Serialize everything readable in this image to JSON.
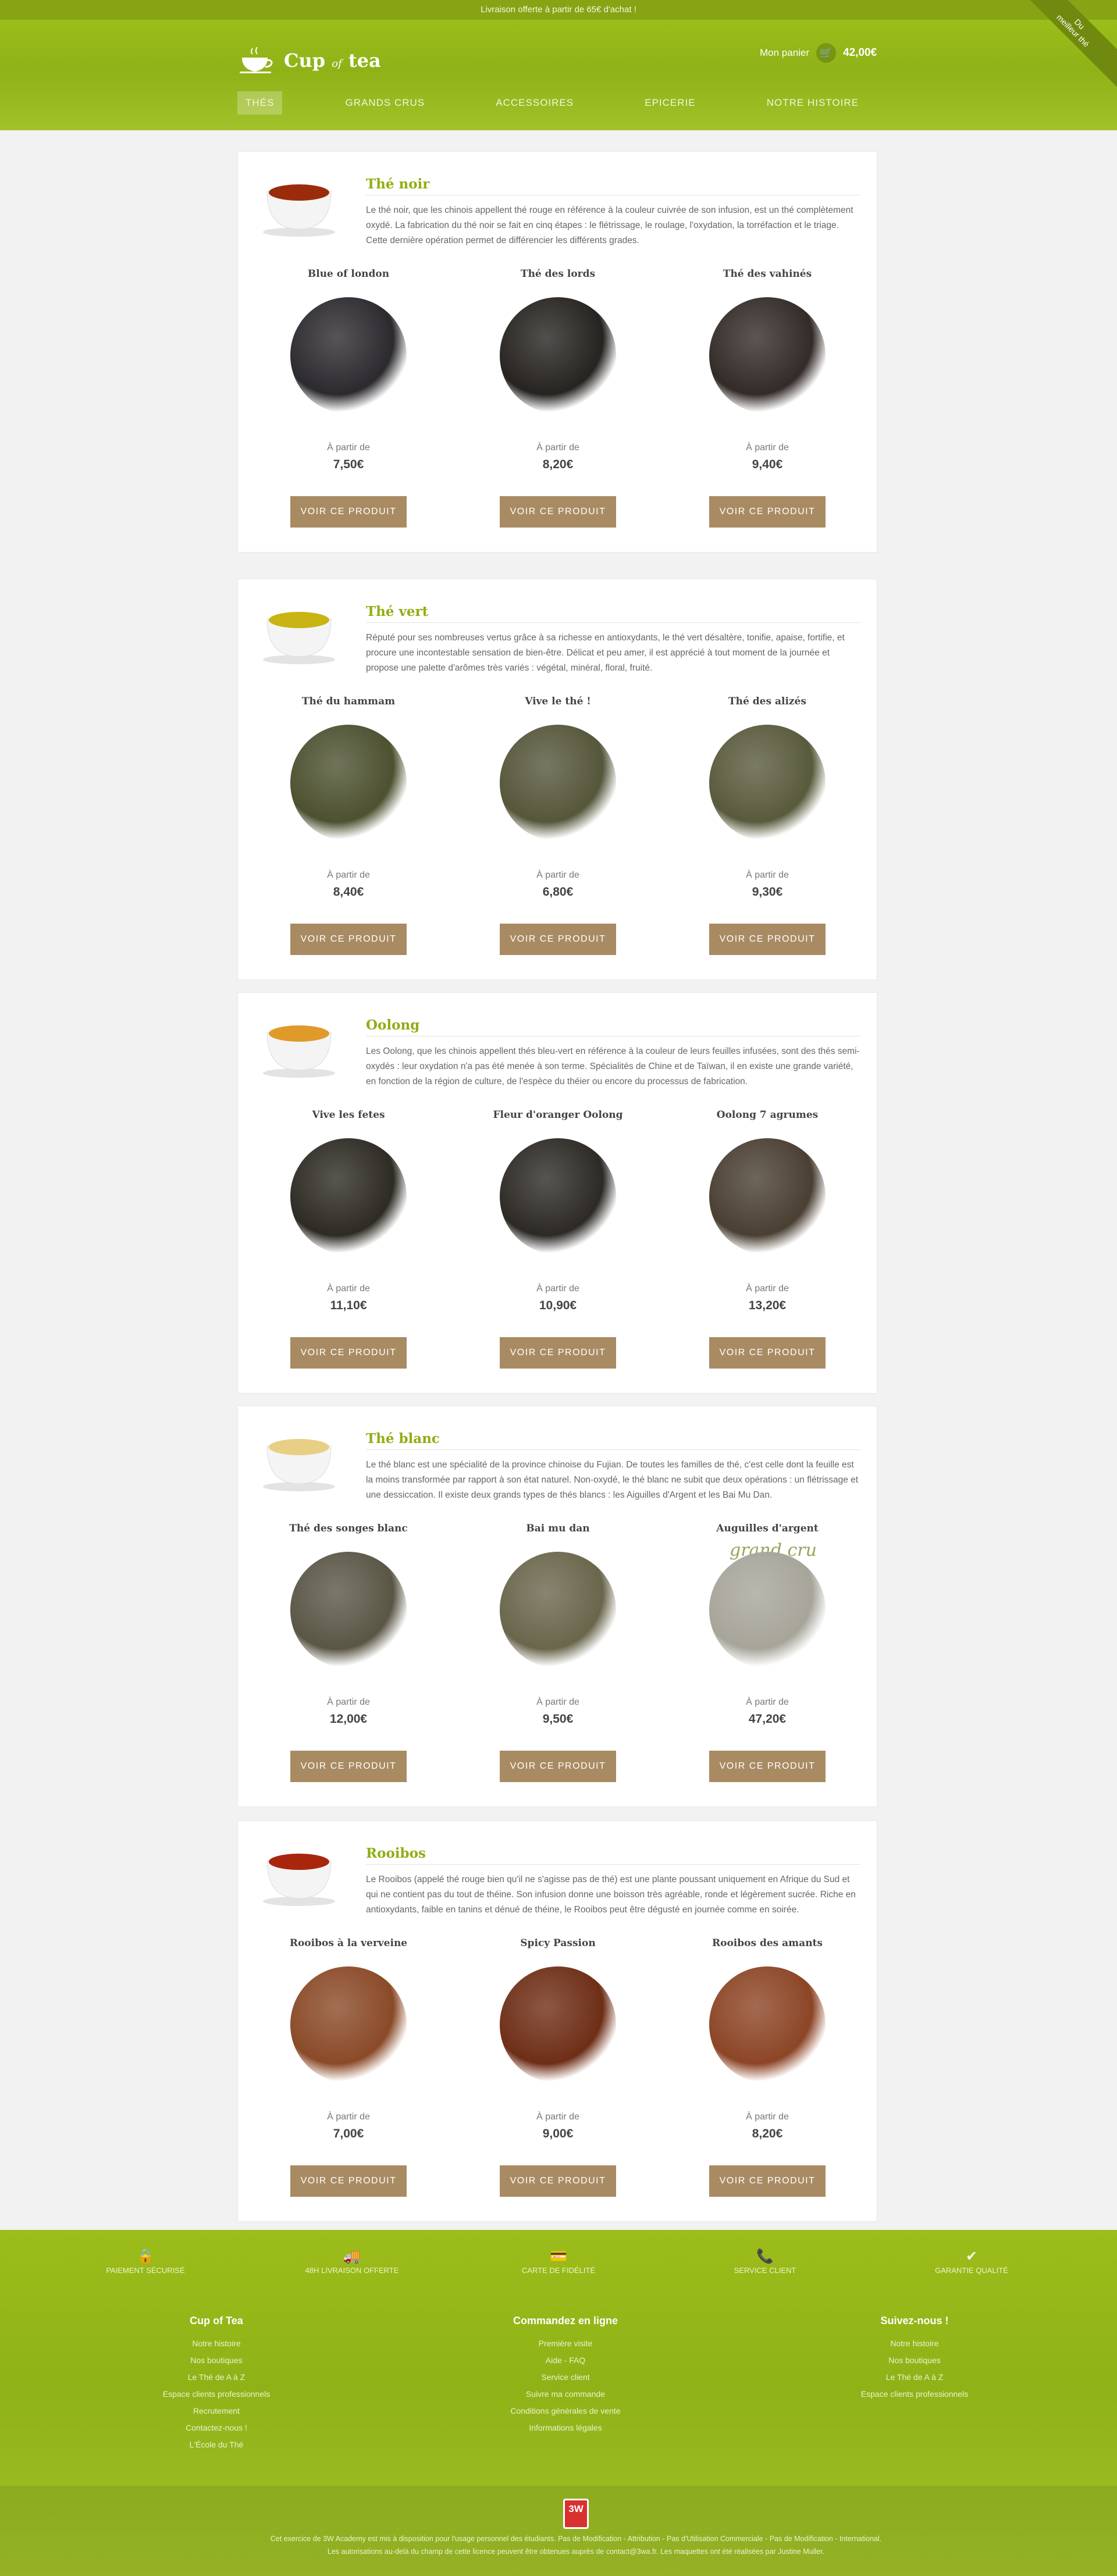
{
  "topbar": {
    "text": "Livraison offerte à partir de 65€ d'achat !"
  },
  "ribbon": {
    "line1": "Du",
    "line2": "meilleur thé"
  },
  "logo": {
    "word1": "Cup",
    "word2": "of",
    "word3": "tea"
  },
  "cart": {
    "label": "Mon panier",
    "amount": "42,00€",
    "icon": "cart-icon"
  },
  "nav": {
    "items": [
      "THÉS",
      "GRANDS CRUS",
      "ACCESSOIRES",
      "EPICERIE",
      "NOTRE HISTOIRE"
    ]
  },
  "sections": [
    {
      "title": "Thé noir",
      "bowl_color": "#9a2c0c",
      "desc": "Le thé noir, que les chinois appellent thé rouge en référence à la couleur cuivrée de son infusion, est un thé complètement oxydé. La fabrication du thé noir se fait en cinq étapes : le flétrissage, le roulage, l'oxydation, la torréfaction et le triage. Cette dernière opération permet de différencier les différents grades.",
      "products": [
        {
          "name": "Blue of london",
          "from": "À partir de",
          "price": "7,50€",
          "button": "VOIR CE PRODUIT",
          "color": "#2c2a2e"
        },
        {
          "name": "Thé des lords",
          "from": "À partir de",
          "price": "8,20€",
          "button": "VOIR CE PRODUIT",
          "color": "#262320"
        },
        {
          "name": "Thé des vahinés",
          "from": "À partir de",
          "price": "9,40€",
          "button": "VOIR CE PRODUIT",
          "color": "#332b28"
        }
      ]
    },
    {
      "title": "Thé vert",
      "bowl_color": "#c8b414",
      "desc": "Réputé pour ses nombreuses vertus grâce à sa richesse en antioxydants, le thé vert désaltère, tonifie, apaise, fortifie, et procure une incontestable sensation de bien-être. Délicat et peu amer, il est apprécié à tout moment de la journée et propose une palette d'arômes très variés : végétal, minéral, floral, fruité.",
      "products": [
        {
          "name": "Thé du hammam",
          "from": "À partir de",
          "price": "8,40€",
          "button": "VOIR CE PRODUIT",
          "color": "#4d5130"
        },
        {
          "name": "Vive le thé !",
          "from": "À partir de",
          "price": "6,80€",
          "button": "VOIR CE PRODUIT",
          "color": "#55563a"
        },
        {
          "name": "Thé des alizés",
          "from": "À partir de",
          "price": "9,30€",
          "button": "VOIR CE PRODUIT",
          "color": "#595a3c"
        }
      ]
    },
    {
      "title": "Oolong",
      "bowl_color": "#e09a2a",
      "desc": "Les Oolong, que les chinois appellent thés bleu-vert en référence à la couleur de leurs feuilles infusées, sont des thés semi-oxydés : leur oxydation n'a pas été menée à son terme. Spécialités de Chine et de Taïwan, il en existe une grande variété, en fonction de la région de culture, de l'espèce du théier ou encore du processus de fabrication.",
      "products": [
        {
          "name": "Vive les fetes",
          "from": "À partir de",
          "price": "11,10€",
          "button": "VOIR CE PRODUIT",
          "color": "#2e2b24"
        },
        {
          "name": "Fleur d'oranger Oolong",
          "from": "À partir de",
          "price": "10,90€",
          "button": "VOIR CE PRODUIT",
          "color": "#2d2a26"
        },
        {
          "name": "Oolong 7 agrumes",
          "from": "À partir de",
          "price": "13,20€",
          "button": "VOIR CE PRODUIT",
          "color": "#4a3f32"
        }
      ]
    },
    {
      "title": "Thé blanc",
      "bowl_color": "#e8cf86",
      "desc": "Le thé blanc est une spécialité de la province chinoise du Fujian. De toutes les familles de thé, c'est celle dont la feuille est la moins transformée par rapport à son état naturel. Non-oxydé, le thé blanc ne subit que deux opérations : un flétrissage et une dessiccation. Il existe deux grands types de thés blancs : les Aiguilles d'Argent et les Bai Mu Dan.",
      "products": [
        {
          "name": "Thé des songes blanc",
          "from": "À partir de",
          "price": "12,00€",
          "button": "VOIR CE PRODUIT",
          "color": "#5a5646",
          "extra": ""
        },
        {
          "name": "Bai mu dan",
          "from": "À partir de",
          "price": "9,50€",
          "button": "VOIR CE PRODUIT",
          "color": "#6a664c",
          "extra": ""
        },
        {
          "name": "Auguilles d'argent",
          "from": "À partir de",
          "price": "47,20€",
          "button": "VOIR CE PRODUIT",
          "color": "#a7a59a",
          "extra": "grand cru"
        }
      ]
    },
    {
      "title": "Rooibos",
      "bowl_color": "#a8260c",
      "desc": "Le Rooibos (appelé thé rouge bien qu'il ne s'agisse pas de thé) est une plante poussant uniquement en Afrique du Sud et qui ne contient pas du tout de théine. Son infusion donne une boisson très agréable, ronde et légèrement sucrée. Riche en antioxydants, faible en tanins et dénué de théine, le Rooibos peut être dégusté en journée comme en soirée.",
      "products": [
        {
          "name": "Rooibos à la verveine",
          "from": "À partir de",
          "price": "7,00€",
          "button": "VOIR CE PRODUIT",
          "color": "#8a4a28"
        },
        {
          "name": "Spicy Passion",
          "from": "À partir de",
          "price": "9,00€",
          "button": "VOIR CE PRODUIT",
          "color": "#6e2e16"
        },
        {
          "name": "Rooibos des amants",
          "from": "À partir de",
          "price": "8,20€",
          "button": "VOIR CE PRODUIT",
          "color": "#8c4526"
        }
      ]
    }
  ],
  "services": [
    {
      "icon": "lock-icon",
      "label": "PAIEMENT SÉCURISÉ"
    },
    {
      "icon": "truck-icon",
      "label": "48H LIVRAISON OFFERTE"
    },
    {
      "icon": "card-icon",
      "label": "CARTE DE FIDÉLITÉ"
    },
    {
      "icon": "phone-icon",
      "label": "SERVICE CLIENT"
    },
    {
      "icon": "check-icon",
      "label": "GARANTIE QUALITÉ"
    }
  ],
  "footer_cols": [
    {
      "title": "Cup of Tea",
      "links": [
        "Notre histoire",
        "Nos boutiques",
        "Le Thé de A à Z",
        "Espace clients professionnels",
        "Recrutement",
        "Contactez-nous !",
        "L'École du Thé"
      ]
    },
    {
      "title": "Commandez en ligne",
      "links": [
        "Première visite",
        "Aide - FAQ",
        "Service client",
        "Suivre ma commande",
        "Conditions générales de vente",
        "Informations légales"
      ]
    },
    {
      "title": "Suivez-nous !",
      "links": [
        "Notre histoire",
        "Nos boutiques",
        "Le Thé de A à Z",
        "Espace clients professionnels"
      ]
    }
  ],
  "legal": {
    "badge": "3W",
    "line1": "Cet exercice de 3W Academy est mis à disposition pour l'usage personnel des étudiants. Pas de Modification - Attribution - Pas d'Utilisation Commerciale - Pas de Modification - International.",
    "line2": "Les autorisations au-delà du champ de cette licence peuvent être obtenues auprès de contact@3wa.fr. Les maquettes ont été réalisées par Justine Muller."
  }
}
